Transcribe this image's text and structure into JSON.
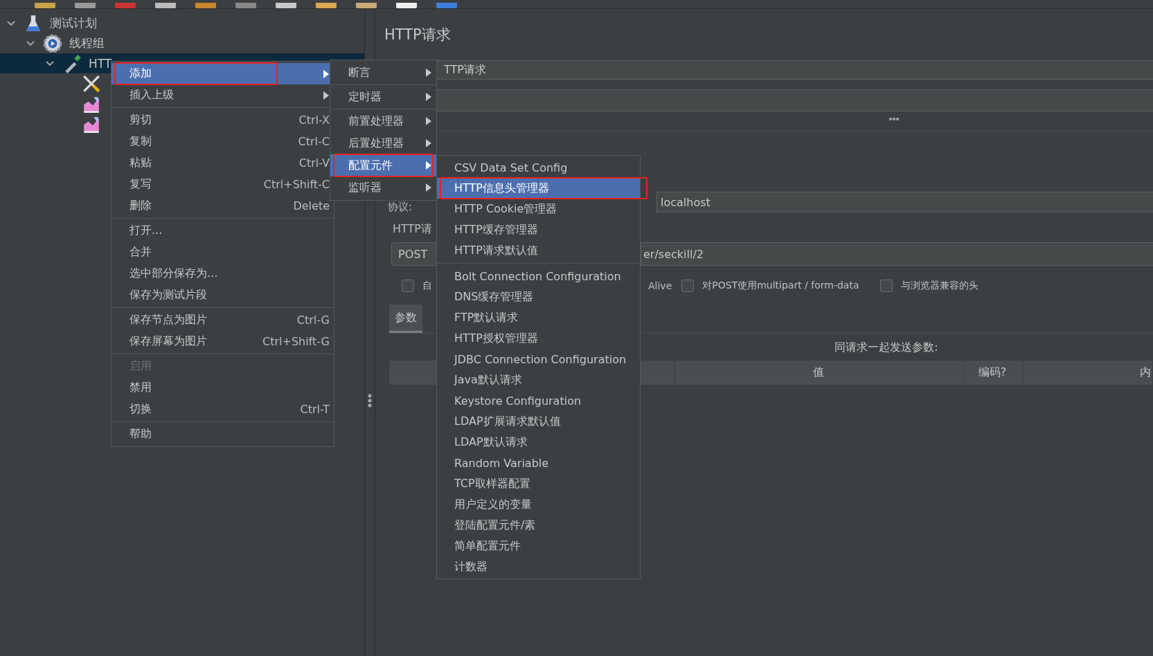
{
  "tree": [
    {
      "label": "测试计划",
      "kind": "plan",
      "expanded": true,
      "selected": false,
      "children": [
        {
          "label": "线程组",
          "kind": "threads",
          "expanded": true,
          "selected": false,
          "children": [
            {
              "label": "HTT",
              "kind": "sampler",
              "expanded": true,
              "selected": true,
              "children": [
                {
                  "kind": "config",
                  "selected": false
                },
                {
                  "kind": "listener",
                  "selected": false
                },
                {
                  "kind": "listener",
                  "selected": false
                }
              ]
            }
          ]
        }
      ]
    }
  ],
  "panel": {
    "title": "HTTP请求",
    "name_field": {
      "value": "TTP请求"
    },
    "protocol_label": "协议:",
    "server_field": {
      "value": "localhost"
    },
    "group_label": "HTTP请",
    "method": {
      "value": "POST"
    },
    "path_field": {
      "value": "er/seckill/2"
    },
    "options": [
      {
        "kind": "checkbox",
        "label": "自",
        "checked": false
      },
      {
        "kind": "text",
        "label": "Alive"
      },
      {
        "kind": "checkbox",
        "label": "对POST使用multipart / form-data",
        "checked": false
      },
      {
        "kind": "checkbox",
        "label": "与浏览器兼容的头",
        "checked": false
      }
    ],
    "tabs": [
      {
        "label": "参数",
        "selected": true
      }
    ],
    "caption": "同请求一起发送参数:",
    "columns": [
      "值",
      "编码?",
      "内"
    ]
  },
  "context_menu": {
    "groups": [
      [
        {
          "label": "添加",
          "submenu": true,
          "selected": true,
          "outlined": true
        },
        {
          "label": "插入上级",
          "submenu": true,
          "selected": false,
          "outlined": false
        }
      ],
      [
        {
          "label": "剪切",
          "shortcut": "Ctrl-X",
          "selected": false,
          "outlined": false
        },
        {
          "label": "复制",
          "shortcut": "Ctrl-C",
          "selected": false,
          "outlined": false
        },
        {
          "label": "粘贴",
          "shortcut": "Ctrl-V",
          "selected": false,
          "outlined": false
        },
        {
          "label": "复写",
          "shortcut": "Ctrl+Shift-C",
          "selected": false,
          "outlined": false
        },
        {
          "label": "删除",
          "shortcut": "Delete",
          "selected": false,
          "outlined": false
        }
      ],
      [
        {
          "label": "打开...",
          "selected": false,
          "outlined": false
        },
        {
          "label": "合并",
          "selected": false,
          "outlined": false
        },
        {
          "label": "选中部分保存为...",
          "selected": false,
          "outlined": false
        },
        {
          "label": "保存为测试片段",
          "selected": false,
          "outlined": false
        }
      ],
      [
        {
          "label": "保存节点为图片",
          "shortcut": "Ctrl-G",
          "selected": false,
          "outlined": false
        },
        {
          "label": "保存屏幕为图片",
          "shortcut": "Ctrl+Shift-G",
          "selected": false,
          "outlined": false
        }
      ],
      [
        {
          "label": "启用",
          "disabled": true,
          "selected": false,
          "outlined": false
        },
        {
          "label": "禁用",
          "disabled": false,
          "selected": false,
          "outlined": false
        },
        {
          "label": "切换",
          "shortcut": "Ctrl-T",
          "disabled": false,
          "selected": false,
          "outlined": false
        }
      ],
      [
        {
          "label": "帮助",
          "selected": false,
          "outlined": false
        }
      ]
    ]
  },
  "add_submenu": {
    "groups": [
      [
        {
          "label": "断言",
          "submenu": true,
          "selected": false,
          "outlined": false
        }
      ],
      [
        {
          "label": "定时器",
          "submenu": true,
          "selected": false,
          "outlined": false
        }
      ],
      [
        {
          "label": "前置处理器",
          "submenu": true,
          "selected": false,
          "outlined": false
        },
        {
          "label": "后置处理器",
          "submenu": true,
          "selected": false,
          "outlined": false
        },
        {
          "label": "配置元件",
          "submenu": true,
          "selected": true,
          "outlined": true
        },
        {
          "label": "监听器",
          "submenu": true,
          "selected": false,
          "outlined": false
        }
      ]
    ]
  },
  "config_submenu": {
    "groups": [
      [
        {
          "label": "CSV Data Set Config",
          "selected": false,
          "outlined": false
        },
        {
          "label": "HTTP信息头管理器",
          "selected": true,
          "outlined": true
        },
        {
          "label": "HTTP Cookie管理器",
          "selected": false,
          "outlined": false
        },
        {
          "label": "HTTP缓存管理器",
          "selected": false,
          "outlined": false
        },
        {
          "label": "HTTP请求默认值",
          "selected": false,
          "outlined": false
        }
      ],
      [
        {
          "label": "Bolt Connection Configuration",
          "selected": false,
          "outlined": false
        },
        {
          "label": "DNS缓存管理器",
          "selected": false,
          "outlined": false
        },
        {
          "label": "FTP默认请求",
          "selected": false,
          "outlined": false
        },
        {
          "label": "HTTP授权管理器",
          "selected": false,
          "outlined": false
        },
        {
          "label": "JDBC Connection Configuration",
          "selected": false,
          "outlined": false
        },
        {
          "label": "Java默认请求",
          "selected": false,
          "outlined": false
        },
        {
          "label": "Keystore Configuration",
          "selected": false,
          "outlined": false
        },
        {
          "label": "LDAP扩展请求默认值",
          "selected": false,
          "outlined": false
        },
        {
          "label": "LDAP默认请求",
          "selected": false,
          "outlined": false
        },
        {
          "label": "Random Variable",
          "selected": false,
          "outlined": false
        },
        {
          "label": "TCP取样器配置",
          "selected": false,
          "outlined": false
        },
        {
          "label": "用户定义的变量",
          "selected": false,
          "outlined": false
        },
        {
          "label": "登陆配置元件/素",
          "selected": false,
          "outlined": false
        },
        {
          "label": "简单配置元件",
          "selected": false,
          "outlined": false
        },
        {
          "label": "计数器",
          "selected": false,
          "outlined": false
        }
      ]
    ]
  }
}
